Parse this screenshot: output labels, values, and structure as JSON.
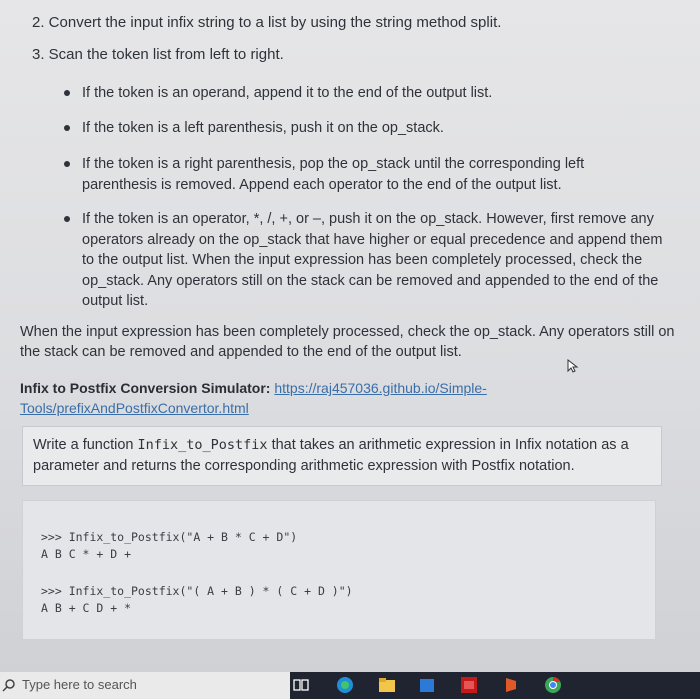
{
  "steps": {
    "step2": "2. Convert the input infix string to a list by using the string method split.",
    "step3": "3. Scan the token list from left to right."
  },
  "bullets": [
    "If the token is an operand, append it to the end of the output list.",
    "If the token is a left parenthesis, push it on the op_stack.",
    "If the token is a right parenthesis, pop the op_stack until the corresponding left parenthesis is removed. Append each operator to the end of the output list.",
    "If the token is an operator, *, /, +, or –, push it on the op_stack. However, first remove any operators already on the op_stack that have higher or equal precedence and append them to the output list. When the input expression has been completely processed, check the op_stack. Any operators still on the stack can be removed and appended to the end of the output list."
  ],
  "closing_paragraph": "When the input expression has been completely processed, check the op_stack. Any operators still on the stack can be removed and appended to the end of the output list.",
  "simulator": {
    "label": "Infix to Postfix Conversion Simulator:",
    "link": "https://raj457036.github.io/Simple-Tools/prefixAndPostfixConvertor.html"
  },
  "task": {
    "prefix": "Write a function ",
    "func_name": "Infix_to_Postfix",
    "suffix": " that takes an arithmetic expression in Infix notation as a parameter and returns the corresponding arithmetic expression with Postfix notation."
  },
  "examples": [
    {
      "call": ">>> Infix_to_Postfix(\"A + B * C + D\")",
      "result": "A B C * + D +"
    },
    {
      "call": ">>> Infix_to_Postfix(\"( A + B ) * ( C + D )\")",
      "result": "A B + C D + *"
    }
  ],
  "taskbar": {
    "search_placeholder": "Type here to search",
    "colors": {
      "bar": "#1f2430",
      "search_bg": "#eaeaea"
    },
    "icons": [
      "task-view-icon",
      "edge-icon",
      "file-explorer-icon",
      "store-icon",
      "mail-icon",
      "office-icon",
      "chrome-icon"
    ]
  }
}
